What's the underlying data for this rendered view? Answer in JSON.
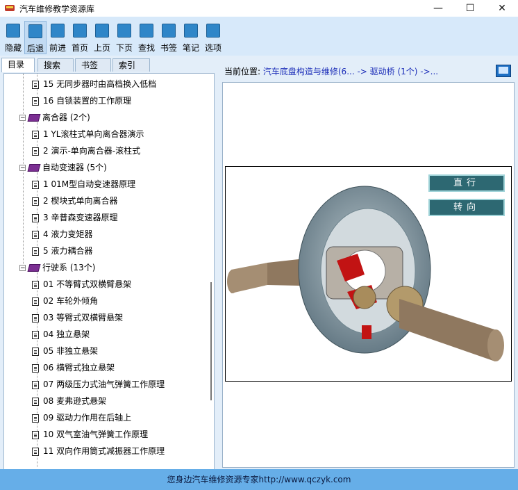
{
  "window": {
    "title": "汽车维修教学资源库",
    "minimize": "—",
    "maximize": "☐",
    "close": "✕"
  },
  "toolbar": {
    "buttons": [
      {
        "label": "隐藏",
        "icon": "hide-icon"
      },
      {
        "label": "后退",
        "icon": "back-arrow-icon"
      },
      {
        "label": "前进",
        "icon": "forward-arrow-icon"
      },
      {
        "label": "首页",
        "icon": "home-icon"
      },
      {
        "label": "上页",
        "icon": "left-arrow-icon"
      },
      {
        "label": "下页",
        "icon": "right-arrow-icon"
      },
      {
        "label": "查找",
        "icon": "search-icon"
      },
      {
        "label": "书签",
        "icon": "bookmark-icon"
      },
      {
        "label": "笔记",
        "icon": "note-icon"
      },
      {
        "label": "选项",
        "icon": "options-icon"
      }
    ]
  },
  "tabs": [
    "目录",
    "搜索",
    "书签",
    "索引"
  ],
  "tree": {
    "items": [
      {
        "text": "15 无同步器时由高档换入低档",
        "type": "doc"
      },
      {
        "text": "16 自锁装置的工作原理",
        "type": "doc"
      },
      {
        "text": "离合器 (2个)",
        "type": "book"
      },
      {
        "text": "1 YL滚柱式单向离合器演示",
        "type": "doc"
      },
      {
        "text": "2 演示-单向离合器-滚柱式",
        "type": "doc"
      },
      {
        "text": "自动变速器 (5个)",
        "type": "book"
      },
      {
        "text": "1 01M型自动变速器原理",
        "type": "doc"
      },
      {
        "text": "2 楔块式单向离合器",
        "type": "doc"
      },
      {
        "text": "3 辛普森变速器原理",
        "type": "doc"
      },
      {
        "text": "4 液力变矩器",
        "type": "doc"
      },
      {
        "text": "5 液力耦合器",
        "type": "doc"
      },
      {
        "text": "行驶系 (13个)",
        "type": "book"
      },
      {
        "text": "01 不等臂式双横臂悬架",
        "type": "doc"
      },
      {
        "text": "02 车轮外倾角",
        "type": "doc"
      },
      {
        "text": "03 等臂式双横臂悬架",
        "type": "doc"
      },
      {
        "text": "04 独立悬架",
        "type": "doc"
      },
      {
        "text": "05 非独立悬架",
        "type": "doc"
      },
      {
        "text": "06 横臂式独立悬架",
        "type": "doc"
      },
      {
        "text": "07 两级压力式油气弹簧工作原理",
        "type": "doc"
      },
      {
        "text": "08 麦弗逊式悬架",
        "type": "doc"
      },
      {
        "text": "09 驱动力作用在后轴上",
        "type": "doc"
      },
      {
        "text": "10 双气室油气弹簧工作原理",
        "type": "doc"
      },
      {
        "text": "11 双向作用筒式减振器工作原理",
        "type": "doc"
      }
    ]
  },
  "location": {
    "label": "当前位置:",
    "path": "汽车底盘构造与维修(6... -> 驱动桥 (1个) ->..."
  },
  "animation": {
    "straight_button": "直行",
    "turn_button": "转向"
  },
  "status": {
    "text": "您身边汽车维修资源专家http://www.qczyk.com"
  },
  "colors": {
    "toolbar_bg": "#d7e9fa",
    "status_bg": "#66aee8",
    "path_text": "#1b2db8"
  }
}
